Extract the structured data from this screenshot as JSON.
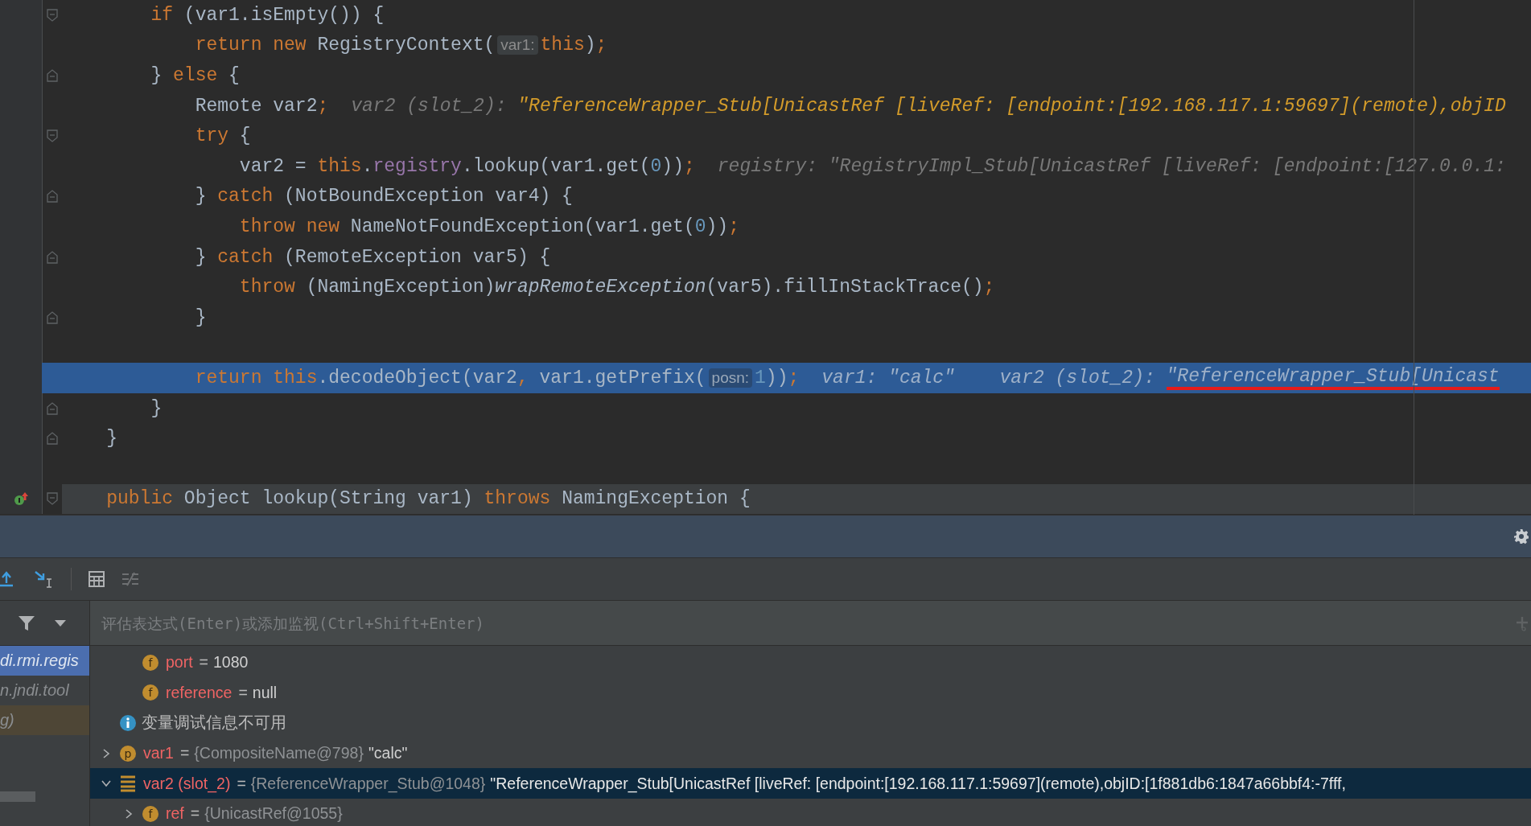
{
  "editor": {
    "lines": [
      {
        "kind": "block_start",
        "current": false,
        "tokens": [
          {
            "kind": "keyword",
            "t": "        if "
          },
          {
            "kind": "plain",
            "t": "(var1.isEmpty()) {"
          }
        ]
      },
      {
        "kind": "plain",
        "current": false,
        "tokens": [
          {
            "kind": "keyword",
            "t": "            return new "
          },
          {
            "kind": "plain",
            "t": "RegistryContext("
          },
          {
            "kind": "inlay",
            "t": "var1:"
          },
          {
            "kind": "keyword",
            "t": "this"
          },
          {
            "kind": "plain",
            "t": ")"
          },
          {
            "kind": "keyword",
            "t": ";"
          }
        ]
      },
      {
        "kind": "block_end",
        "current": false,
        "tokens": [
          {
            "kind": "plain",
            "t": "        } "
          },
          {
            "kind": "keyword",
            "t": "else "
          },
          {
            "kind": "plain",
            "t": "{"
          }
        ]
      },
      {
        "kind": "plain",
        "current": false,
        "tokens": [
          {
            "kind": "plain",
            "t": "            Remote var2"
          },
          {
            "kind": "keyword",
            "t": ";"
          },
          {
            "kind": "hint",
            "t": "var2 (slot_2): "
          },
          {
            "kind": "changed",
            "t": "\"ReferenceWrapper_Stub[UnicastRef [liveRef: [endpoint:[192.168.117.1:59697](remote),objID"
          }
        ]
      },
      {
        "kind": "block_start",
        "current": false,
        "tokens": [
          {
            "kind": "keyword",
            "t": "            try "
          },
          {
            "kind": "plain",
            "t": "{"
          }
        ]
      },
      {
        "kind": "plain",
        "current": false,
        "tokens": [
          {
            "kind": "plain",
            "t": "                var2 = "
          },
          {
            "kind": "keyword",
            "t": "this"
          },
          {
            "kind": "plain",
            "t": "."
          },
          {
            "kind": "field",
            "t": "registry"
          },
          {
            "kind": "plain",
            "t": ".lookup(var1.get("
          },
          {
            "kind": "number",
            "t": "0"
          },
          {
            "kind": "plain",
            "t": "))"
          },
          {
            "kind": "keyword",
            "t": ";"
          },
          {
            "kind": "hint",
            "t": "registry: \"RegistryImpl_Stub[UnicastRef [liveRef: [endpoint:[127.0.0.1:"
          }
        ]
      },
      {
        "kind": "block_end",
        "current": false,
        "tokens": [
          {
            "kind": "plain",
            "t": "            } "
          },
          {
            "kind": "keyword",
            "t": "catch "
          },
          {
            "kind": "plain",
            "t": "(NotBoundException var4) {"
          }
        ]
      },
      {
        "kind": "plain",
        "current": false,
        "tokens": [
          {
            "kind": "keyword",
            "t": "                throw new "
          },
          {
            "kind": "plain",
            "t": "NameNotFoundException(var1.get("
          },
          {
            "kind": "number",
            "t": "0"
          },
          {
            "kind": "plain",
            "t": "))"
          },
          {
            "kind": "keyword",
            "t": ";"
          }
        ]
      },
      {
        "kind": "block_end",
        "current": false,
        "tokens": [
          {
            "kind": "plain",
            "t": "            } "
          },
          {
            "kind": "keyword",
            "t": "catch "
          },
          {
            "kind": "plain",
            "t": "(RemoteException var5) {"
          }
        ]
      },
      {
        "kind": "plain",
        "current": false,
        "tokens": [
          {
            "kind": "keyword",
            "t": "                throw "
          },
          {
            "kind": "plain",
            "t": "(NamingException)"
          },
          {
            "kind": "method",
            "t": "wrapRemoteException"
          },
          {
            "kind": "plain",
            "t": "(var5).fillInStackTrace()"
          },
          {
            "kind": "keyword",
            "t": ";"
          }
        ]
      },
      {
        "kind": "block_end",
        "current": false,
        "tokens": [
          {
            "kind": "plain",
            "t": "            }"
          }
        ]
      },
      {
        "kind": "plain",
        "current": false
      },
      {
        "kind": "plain",
        "current": true,
        "tokens": [
          {
            "kind": "keyword",
            "t": "            return this"
          },
          {
            "kind": "plain",
            "t": ".decodeObject(var2"
          },
          {
            "kind": "keyword",
            "t": ", "
          },
          {
            "kind": "plain",
            "t": "var1.getPrefix("
          },
          {
            "kind": "inlay",
            "t": "posn:"
          },
          {
            "kind": "number",
            "t": "1"
          },
          {
            "kind": "plain",
            "t": "))"
          },
          {
            "kind": "keyword",
            "t": ";"
          },
          {
            "kind": "hint",
            "t": "var1: \"calc\""
          },
          {
            "kind": "hint",
            "t": "  var2 (slot_2): "
          },
          {
            "kind": "marked",
            "t": "\"ReferenceWrapper_Stub[Unicast"
          }
        ]
      },
      {
        "kind": "block_end",
        "current": false,
        "tokens": [
          {
            "kind": "plain",
            "t": "        }"
          }
        ]
      },
      {
        "kind": "block_end",
        "current": false,
        "tokens": [
          {
            "kind": "plain",
            "t": "    }"
          }
        ]
      },
      {
        "kind": "plain",
        "current": false
      },
      {
        "kind": "declaration",
        "current": false,
        "tokens": [
          {
            "kind": "keyword",
            "t": "    public "
          },
          {
            "kind": "plain",
            "t": "Object lookup(String var1) "
          },
          {
            "kind": "keyword",
            "t": "throws "
          },
          {
            "kind": "plain",
            "t": "NamingException {"
          }
        ]
      }
    ]
  },
  "debugger": {
    "evaluate": {
      "placeholder": "评估表达式(Enter)或添加监视(Ctrl+Shift+Enter)"
    },
    "frames": [
      {
        "text": "di.rmi.regis",
        "selected": true,
        "library": false
      },
      {
        "text": "n.jndi.tool",
        "selected": false,
        "library": false
      },
      {
        "text": "g)",
        "selected": false,
        "library": true
      }
    ],
    "variables": {
      "continued_children": [
        {
          "kind": "member",
          "badge": "f",
          "name": "port",
          "operator": "=",
          "value": "1080",
          "selected": false
        },
        {
          "kind": "member",
          "badge": "f",
          "name": "reference",
          "operator": "=",
          "value": "null",
          "selected": false
        }
      ],
      "items": [
        {
          "kind": "info",
          "value": "变量调试信息不可用",
          "selected": false
        },
        {
          "kind": "member",
          "badge": "p",
          "name": "var1",
          "operator": "=",
          "type": "{CompositeName@798}",
          "value": "\"calc\"",
          "expanded": false,
          "selected": false
        },
        {
          "kind": "array",
          "name": "var2 (slot_2)",
          "operator": "=",
          "type": "{ReferenceWrapper_Stub@1048}",
          "value": "\"ReferenceWrapper_Stub[UnicastRef [liveRef: [endpoint:[192.168.117.1:59697](remote),objID:[1f881db6:1847a66bbf4:-7fff,",
          "expanded": true,
          "selected": true,
          "children": [
            {
              "kind": "member",
              "badge": "f",
              "name": "ref",
              "operator": "=",
              "type": "{UnicastRef@1055}",
              "expanded": false,
              "selected": false
            }
          ]
        }
      ]
    }
  }
}
